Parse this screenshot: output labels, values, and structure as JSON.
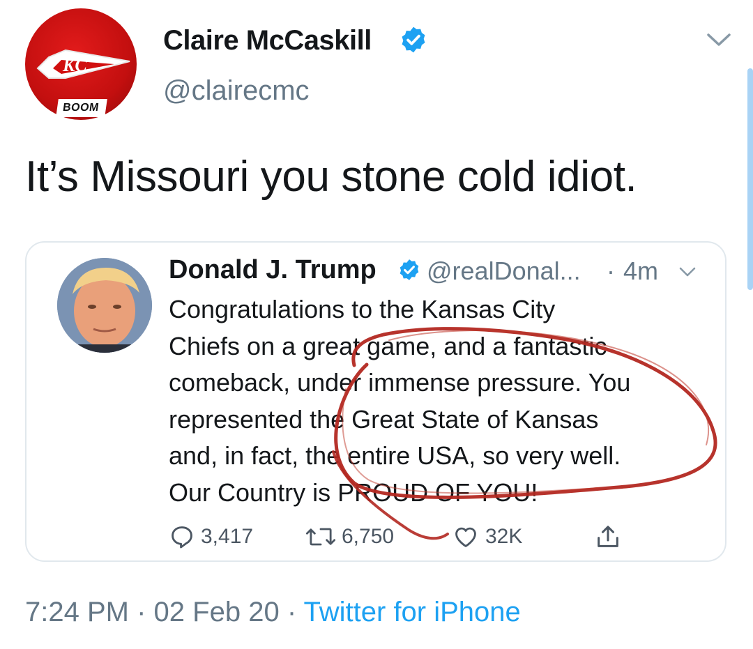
{
  "tweet": {
    "author": {
      "name": "Claire McCaskill",
      "handle": "@clairecmc",
      "avatar_icon": "kansas-city-chiefs-logo-icon",
      "avatar_badge": "BOOM",
      "verified": true
    },
    "text": "It’s Missouri you stone cold idiot.",
    "timestamp": "7:24 PM",
    "separator": "·",
    "date": "02 Feb 20",
    "source": "Twitter for iPhone"
  },
  "quoted_tweet": {
    "author": {
      "name": "Donald J. Trump",
      "handle": "@realDonal...",
      "verified": true
    },
    "dot": "·",
    "time_ago": "4m",
    "body_lines": [
      "Congratulations to the Kansas City",
      "Chiefs on a great game, and a fantastic",
      "comeback, under immense pressure. You",
      "represented the Great State of Kansas",
      "and, in fact, the entire USA, so very well.",
      "Our Country is PROUD OF YOU!"
    ],
    "actions": {
      "replies": "3,417",
      "retweets": "6,750",
      "likes": "32K"
    }
  },
  "colors": {
    "text": "#14171a",
    "secondary": "#657786",
    "link": "#1da1f2",
    "verified": "#1da1f2",
    "annotation": "#b32821",
    "card_border": "#e1e8ed"
  },
  "icons": {
    "verified": "verified-badge-icon",
    "more": "chevron-down-icon",
    "reply": "reply-icon",
    "retweet": "retweet-icon",
    "like": "heart-icon",
    "share": "share-icon"
  }
}
